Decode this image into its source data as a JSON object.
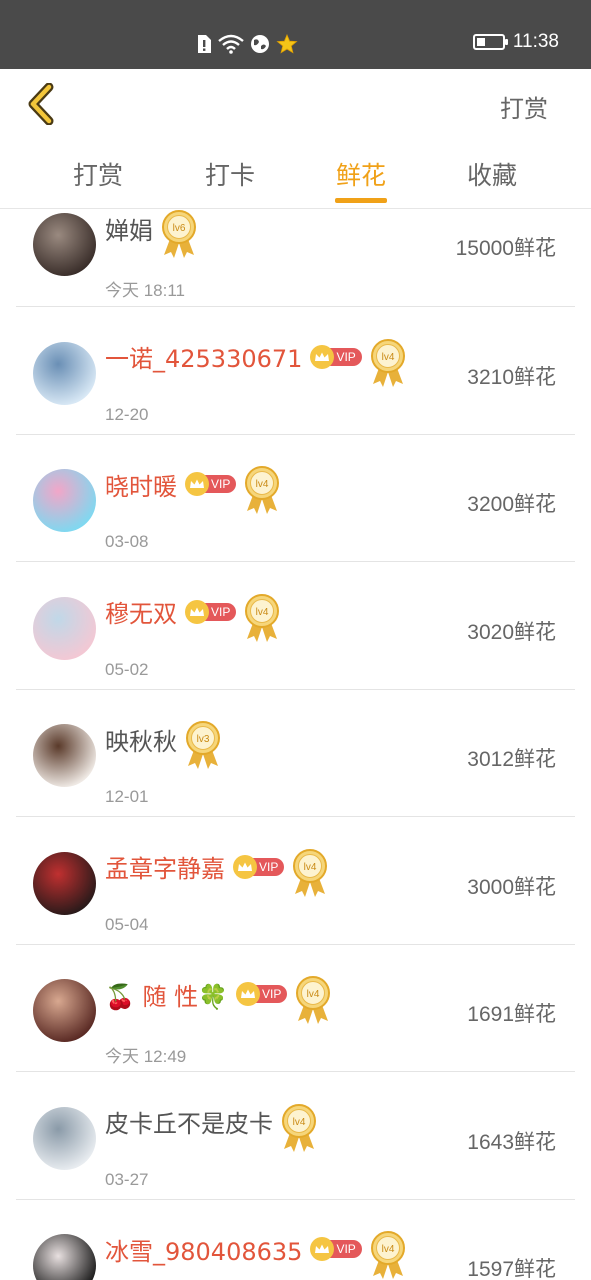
{
  "status_bar": {
    "time": "11:38",
    "battery_level": 0.35,
    "icons": [
      "sim-alert-icon",
      "wifi-icon",
      "globe-icon",
      "star-icon"
    ]
  },
  "nav": {
    "back_icon": "chevron-left-icon",
    "action_label": "打赏"
  },
  "tabs": [
    {
      "label": "打赏",
      "active": false
    },
    {
      "label": "打卡",
      "active": false
    },
    {
      "label": "鲜花",
      "active": true
    },
    {
      "label": "收藏",
      "active": false
    }
  ],
  "accent_color": "#f0a118",
  "vip_name_color": "#e2553b",
  "vip_label": "VIP",
  "entries": [
    {
      "name": "婵娟",
      "vip": false,
      "level": "lv6",
      "date": "今天 18:11",
      "amount": "15000鲜花",
      "avatar_colors": [
        "#3a2e2a",
        "#9a8a80"
      ]
    },
    {
      "name": "一诺_425330671",
      "vip": true,
      "level": "lv4",
      "date": "12-20",
      "amount": "3210鲜花",
      "avatar_colors": [
        "#d8e8f5",
        "#6a8fb5"
      ]
    },
    {
      "name": "晓时暖",
      "vip": true,
      "level": "lv4",
      "date": "03-08",
      "amount": "3200鲜花",
      "avatar_colors": [
        "#7fd8f0",
        "#f2a6c8"
      ]
    },
    {
      "name": "穆无双",
      "vip": true,
      "level": "lv4",
      "date": "05-02",
      "amount": "3020鲜花",
      "avatar_colors": [
        "#f3c8d4",
        "#c0d8e8"
      ]
    },
    {
      "name": "映秋秋",
      "vip": false,
      "level": "lv3",
      "date": "12-01",
      "amount": "3012鲜花",
      "avatar_colors": [
        "#efe9e4",
        "#5a3a2a"
      ]
    },
    {
      "name": "孟章字静嘉",
      "vip": true,
      "level": "lv4",
      "date": "05-04",
      "amount": "3000鲜花",
      "avatar_colors": [
        "#2a1a1a",
        "#c03030"
      ]
    },
    {
      "name": "🍒 随 性🍀",
      "vip": true,
      "level": "lv4",
      "date": "今天 12:49",
      "amount": "1691鲜花",
      "avatar_colors": [
        "#5a2a24",
        "#d8a890"
      ]
    },
    {
      "name": "皮卡丘不是皮卡",
      "vip": false,
      "level": "lv4",
      "date": "03-27",
      "amount": "1643鲜花",
      "avatar_colors": [
        "#e8ecf0",
        "#8a9aa8"
      ]
    },
    {
      "name": "冰雪_980408635",
      "vip": true,
      "level": "lv4",
      "date": "",
      "amount": "1597鲜花",
      "avatar_colors": [
        "#1a1a1a",
        "#e8e0e0"
      ]
    }
  ]
}
